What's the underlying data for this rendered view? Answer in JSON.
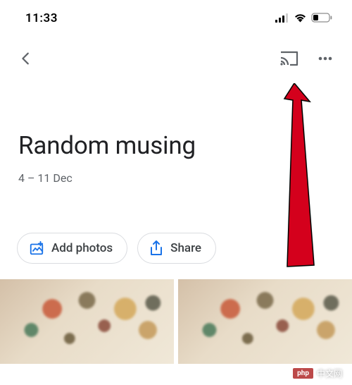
{
  "status": {
    "time": "11:33"
  },
  "album": {
    "title": "Random musing",
    "date_range": "4 – 11 Dec"
  },
  "actions": {
    "add_photos": "Add photos",
    "share": "Share"
  },
  "watermark": {
    "badge": "php",
    "text": "中文网"
  },
  "colors": {
    "accent_blue": "#1a73e8",
    "text_primary": "#202124",
    "text_secondary": "#5f6368",
    "border": "#dadce0",
    "annotation_red": "#d4001f"
  }
}
